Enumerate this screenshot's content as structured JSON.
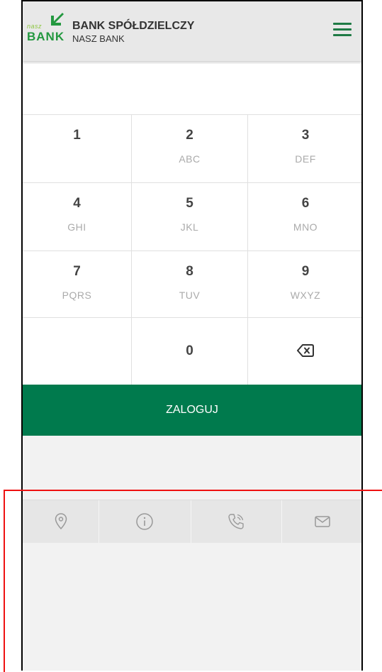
{
  "header": {
    "logo_small": "nasz",
    "logo_big": "BANK",
    "title": "BANK SPÓŁDZIELCZY",
    "subtitle": "NASZ BANK"
  },
  "keypad": {
    "keys": [
      {
        "digit": "1",
        "letters": ""
      },
      {
        "digit": "2",
        "letters": "ABC"
      },
      {
        "digit": "3",
        "letters": "DEF"
      },
      {
        "digit": "4",
        "letters": "GHI"
      },
      {
        "digit": "5",
        "letters": "JKL"
      },
      {
        "digit": "6",
        "letters": "MNO"
      },
      {
        "digit": "7",
        "letters": "PQRS"
      },
      {
        "digit": "8",
        "letters": "TUV"
      },
      {
        "digit": "9",
        "letters": "WXYZ"
      },
      {
        "digit": "",
        "letters": ""
      },
      {
        "digit": "0",
        "letters": ""
      }
    ]
  },
  "login_label": "ZALOGUJ",
  "bottom_icons": [
    "location-pin-icon",
    "info-icon",
    "phone-icon",
    "envelope-icon"
  ],
  "colors": {
    "accent": "#007a4d",
    "menu": "#1f7a45",
    "logo_green": "#23983f"
  }
}
